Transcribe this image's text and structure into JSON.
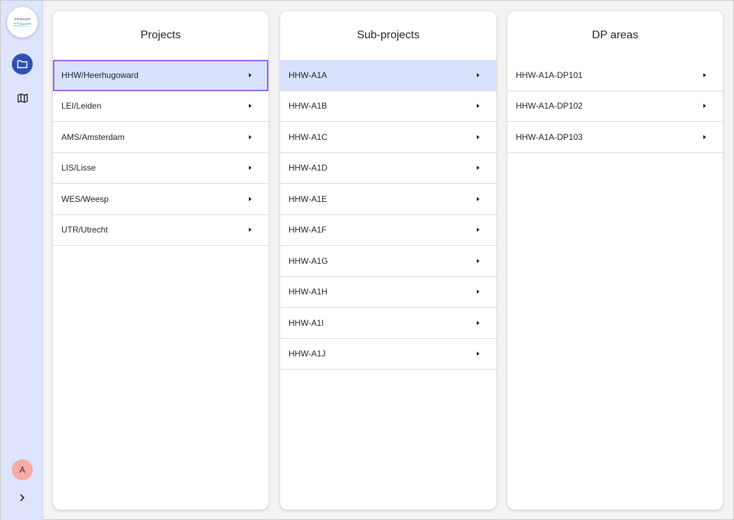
{
  "sidebar": {
    "logo_text": "Inframent",
    "nav": [
      {
        "icon": "folder-icon",
        "active": true
      },
      {
        "icon": "map-icon",
        "active": false
      }
    ],
    "avatar_initial": "A",
    "expand_icon": "chevron-right-icon"
  },
  "panels": {
    "projects": {
      "title": "Projects",
      "items": [
        "HHW/Heerhugoward",
        "LEI/Leiden",
        "AMS/Amsterdam",
        "LIS/Lisse",
        "WES/Weesp",
        "UTR/Utrecht"
      ],
      "selected_index": 0
    },
    "subprojects": {
      "title": "Sub-projects",
      "items": [
        "HHW-A1A",
        "HHW-A1B",
        "HHW-A1C",
        "HHW-A1D",
        "HHW-A1E",
        "HHW-A1F",
        "HHW-A1G",
        "HHW-A1H",
        "HHW-A1I",
        "HHW-A1J"
      ],
      "selected_index": 0
    },
    "dp_areas": {
      "title": "DP areas",
      "items": [
        "HHW-A1A-DP101",
        "HHW-A1A-DP102",
        "HHW-A1A-DP103"
      ],
      "selected_index": -1
    }
  },
  "colors": {
    "sidebar_bg": "#dde4fb",
    "selected_row": "#d8e2fc",
    "focus_outline": "#9b5cf0",
    "nav_active": "#2f52b0",
    "avatar_bg": "#f7aaa6"
  }
}
